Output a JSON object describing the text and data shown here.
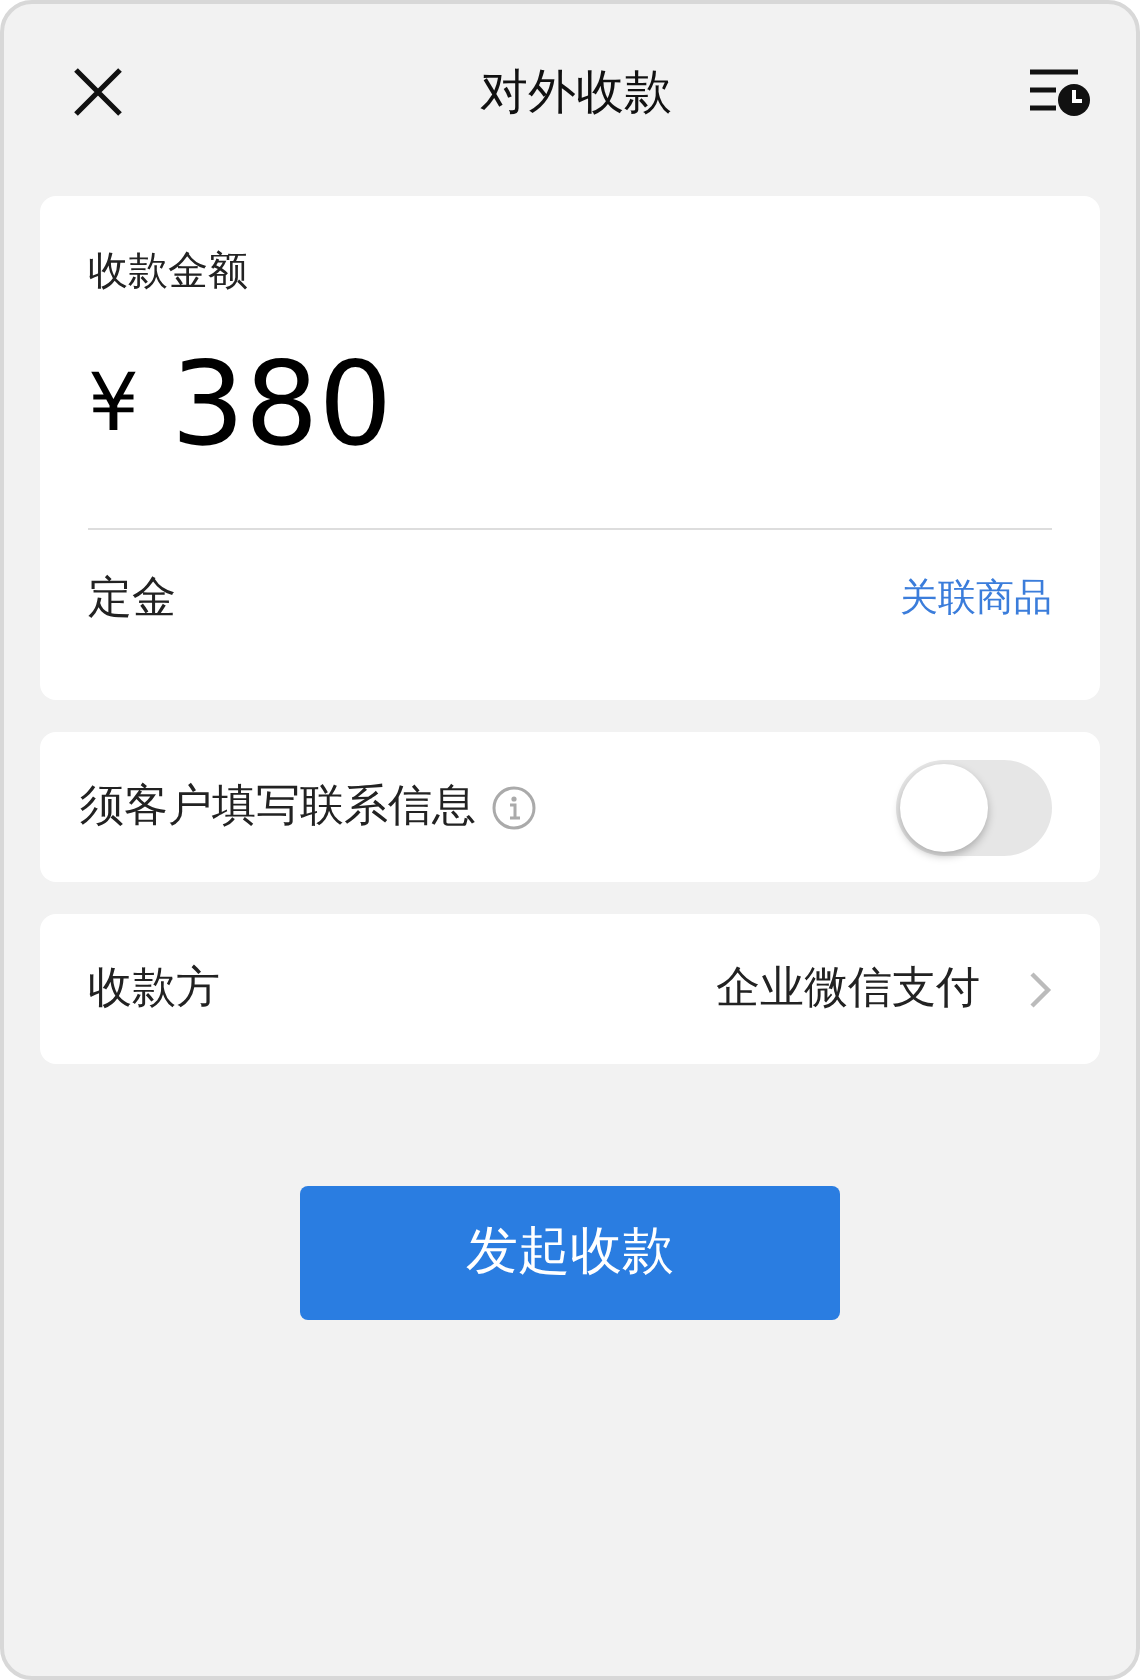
{
  "header": {
    "title": "对外收款"
  },
  "amount_card": {
    "label": "收款金额",
    "currency": "¥",
    "amount": "380",
    "remark": "定金",
    "link": "关联商品"
  },
  "contact_setting": {
    "label": "须客户填写联系信息",
    "on": false
  },
  "payee": {
    "label": "收款方",
    "value": "企业微信支付"
  },
  "submit_button": "发起收款"
}
